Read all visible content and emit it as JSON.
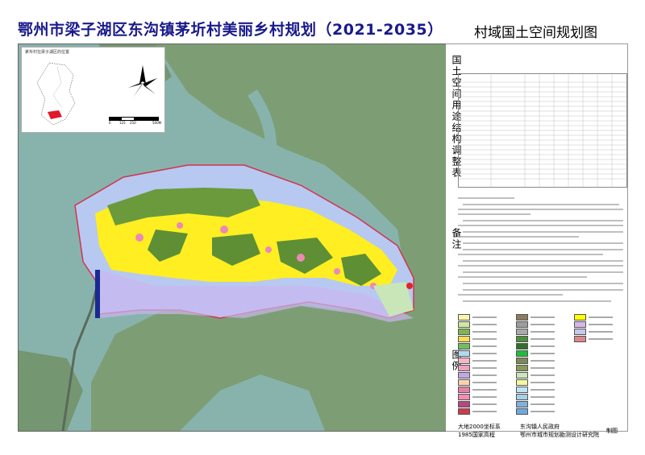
{
  "title": "鄂州市梁子湖区东沟镇茅圻村美丽乡村规划（2021-2035）",
  "subtitle": "村域国土空间规划图",
  "inset": {
    "title": "茅圻村在梁子湖区的位置",
    "scale_labels": [
      "0",
      "125",
      "250",
      "500M"
    ]
  },
  "panel_labels": {
    "table": "国土空间用途结构调整表",
    "notes": "备注",
    "legend": "图例"
  },
  "legend_swatch_colors": [
    "#fff7a8",
    "#cde8a0",
    "#7fb84a",
    "#ffdd55",
    "#6fbf5c",
    "#b7d7f0",
    "#f6b6c9",
    "#f1a1c0",
    "#c3a6e6",
    "#ffd1b0",
    "#e67ea8",
    "#f28bb5",
    "#b8467f",
    "#c93c4a",
    "#8b7b5f",
    "#9d9da0",
    "#aaaaaa",
    "#4d8f3a",
    "#2f6f2a",
    "#1ebd3a",
    "#7a8a55",
    "#8a9a5c",
    "#c9e6b8",
    "#f3f7a0",
    "#bfe3f5",
    "#a8cfe8",
    "#7fb1dc",
    "#6ea9e0",
    "#ffff00",
    "#d7b7e8",
    "#c7c7e8",
    "#dd8888"
  ],
  "footer": {
    "coord": "大地2000坐标系",
    "elev": "1985国家高程",
    "org1": "东沟镇人民政府",
    "org2": "鄂州市城市规划勘测设计研究院",
    "made": "制图"
  }
}
